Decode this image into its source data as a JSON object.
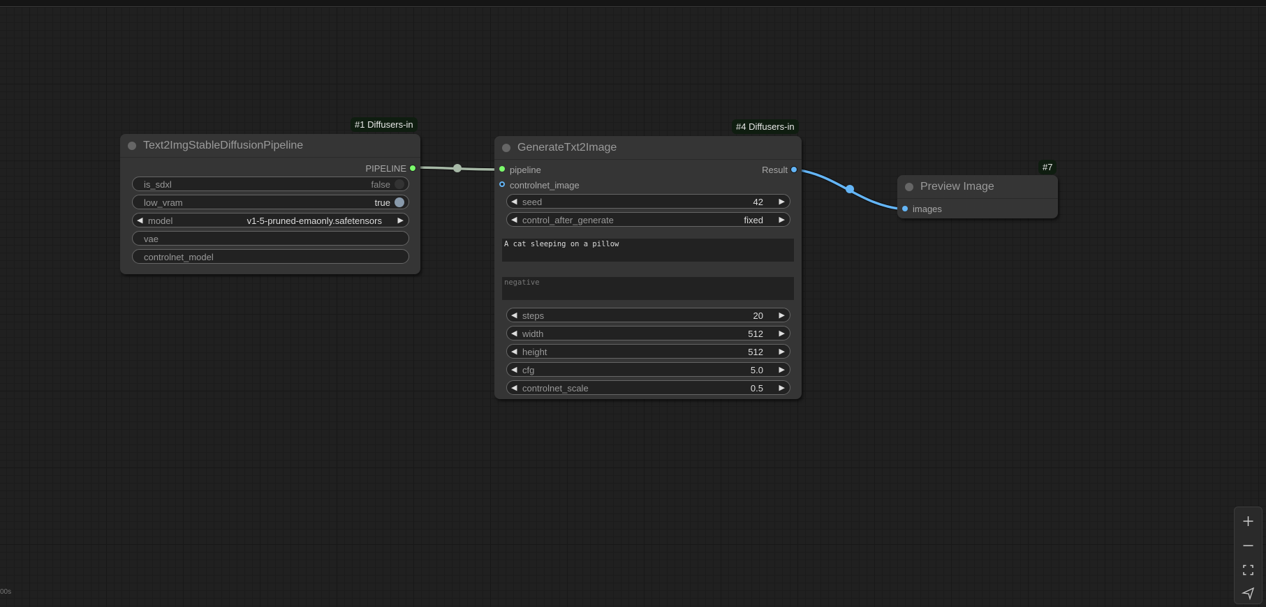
{
  "canvas": {
    "status_text": "00s"
  },
  "colors": {
    "pipeline_link": "#a6b8a6",
    "image_link": "#64b5f6",
    "pipeline_slot": "#7cfc6c",
    "image_slot": "#64b5f6",
    "badge_bg": "#0f1d10",
    "toggle_on": "#8899aa",
    "toggle_off": "#333333"
  },
  "nodes": {
    "pipeline": {
      "badge": "#1 Diffusers-in",
      "title": "Text2ImgStableDiffusionPipeline",
      "output": "PIPELINE",
      "widgets": {
        "is_sdxl": {
          "label": "is_sdxl",
          "value": "false"
        },
        "low_vram": {
          "label": "low_vram",
          "value": "true"
        },
        "model": {
          "label": "model",
          "value": "v1-5-pruned-emaonly.safetensors"
        },
        "vae": {
          "label": "vae"
        },
        "controlnet_model": {
          "label": "controlnet_model"
        }
      }
    },
    "generate": {
      "badge": "#4 Diffusers-in",
      "title": "GenerateTxt2Image",
      "inputs": [
        "pipeline",
        "controlnet_image"
      ],
      "output": "Result",
      "widgets": {
        "seed": {
          "label": "seed",
          "value": "42"
        },
        "control_after_generate": {
          "label": "control_after_generate",
          "value": "fixed"
        },
        "positive": {
          "value": "A cat sleeping on a pillow"
        },
        "negative": {
          "placeholder": "negative"
        },
        "steps": {
          "label": "steps",
          "value": "20"
        },
        "width": {
          "label": "width",
          "value": "512"
        },
        "height": {
          "label": "height",
          "value": "512"
        },
        "cfg": {
          "label": "cfg",
          "value": "5.0"
        },
        "controlnet_scale": {
          "label": "controlnet_scale",
          "value": "0.5"
        }
      }
    },
    "preview": {
      "badge": "#7",
      "title": "Preview Image",
      "input": "images"
    }
  },
  "zoom_controls": [
    "zoom-in",
    "zoom-out",
    "fit-view",
    "locate"
  ]
}
